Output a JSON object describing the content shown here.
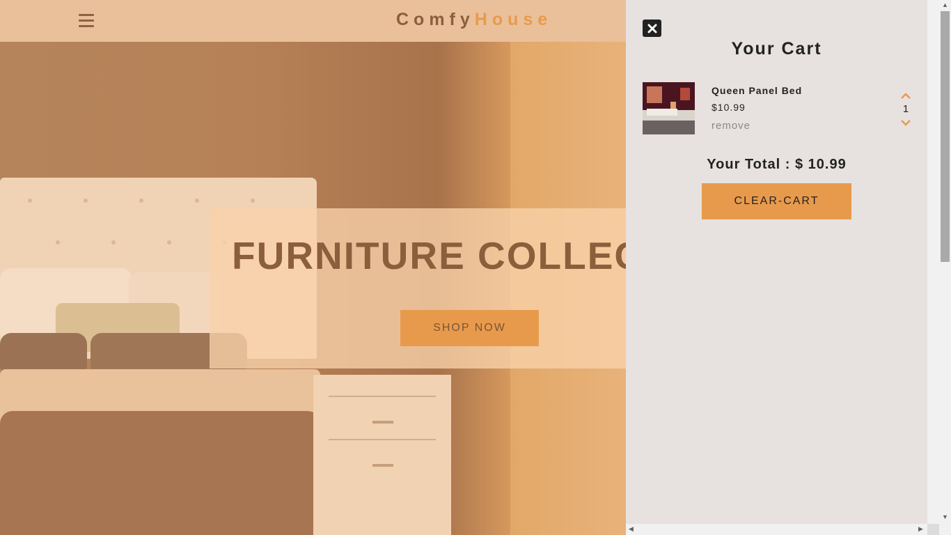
{
  "navbar": {
    "logo_part1": "Comfy",
    "logo_part2": "House",
    "menu_icon": "hamburger-icon"
  },
  "hero": {
    "title": "FURNITURE COLLECTION",
    "shop_button": "SHOP NOW"
  },
  "cart": {
    "close_icon": "close-icon",
    "title": "Your Cart",
    "items": [
      {
        "name": "Queen Panel Bed",
        "price": "$10.99",
        "remove_label": "remove",
        "quantity": "1"
      }
    ],
    "total_label": "Your Total : $ 10.99",
    "clear_button": "CLEAR-CART"
  },
  "colors": {
    "accent": "#e89a4c",
    "brown": "#8b5e3c",
    "cart_bg": "#e7e2df"
  }
}
